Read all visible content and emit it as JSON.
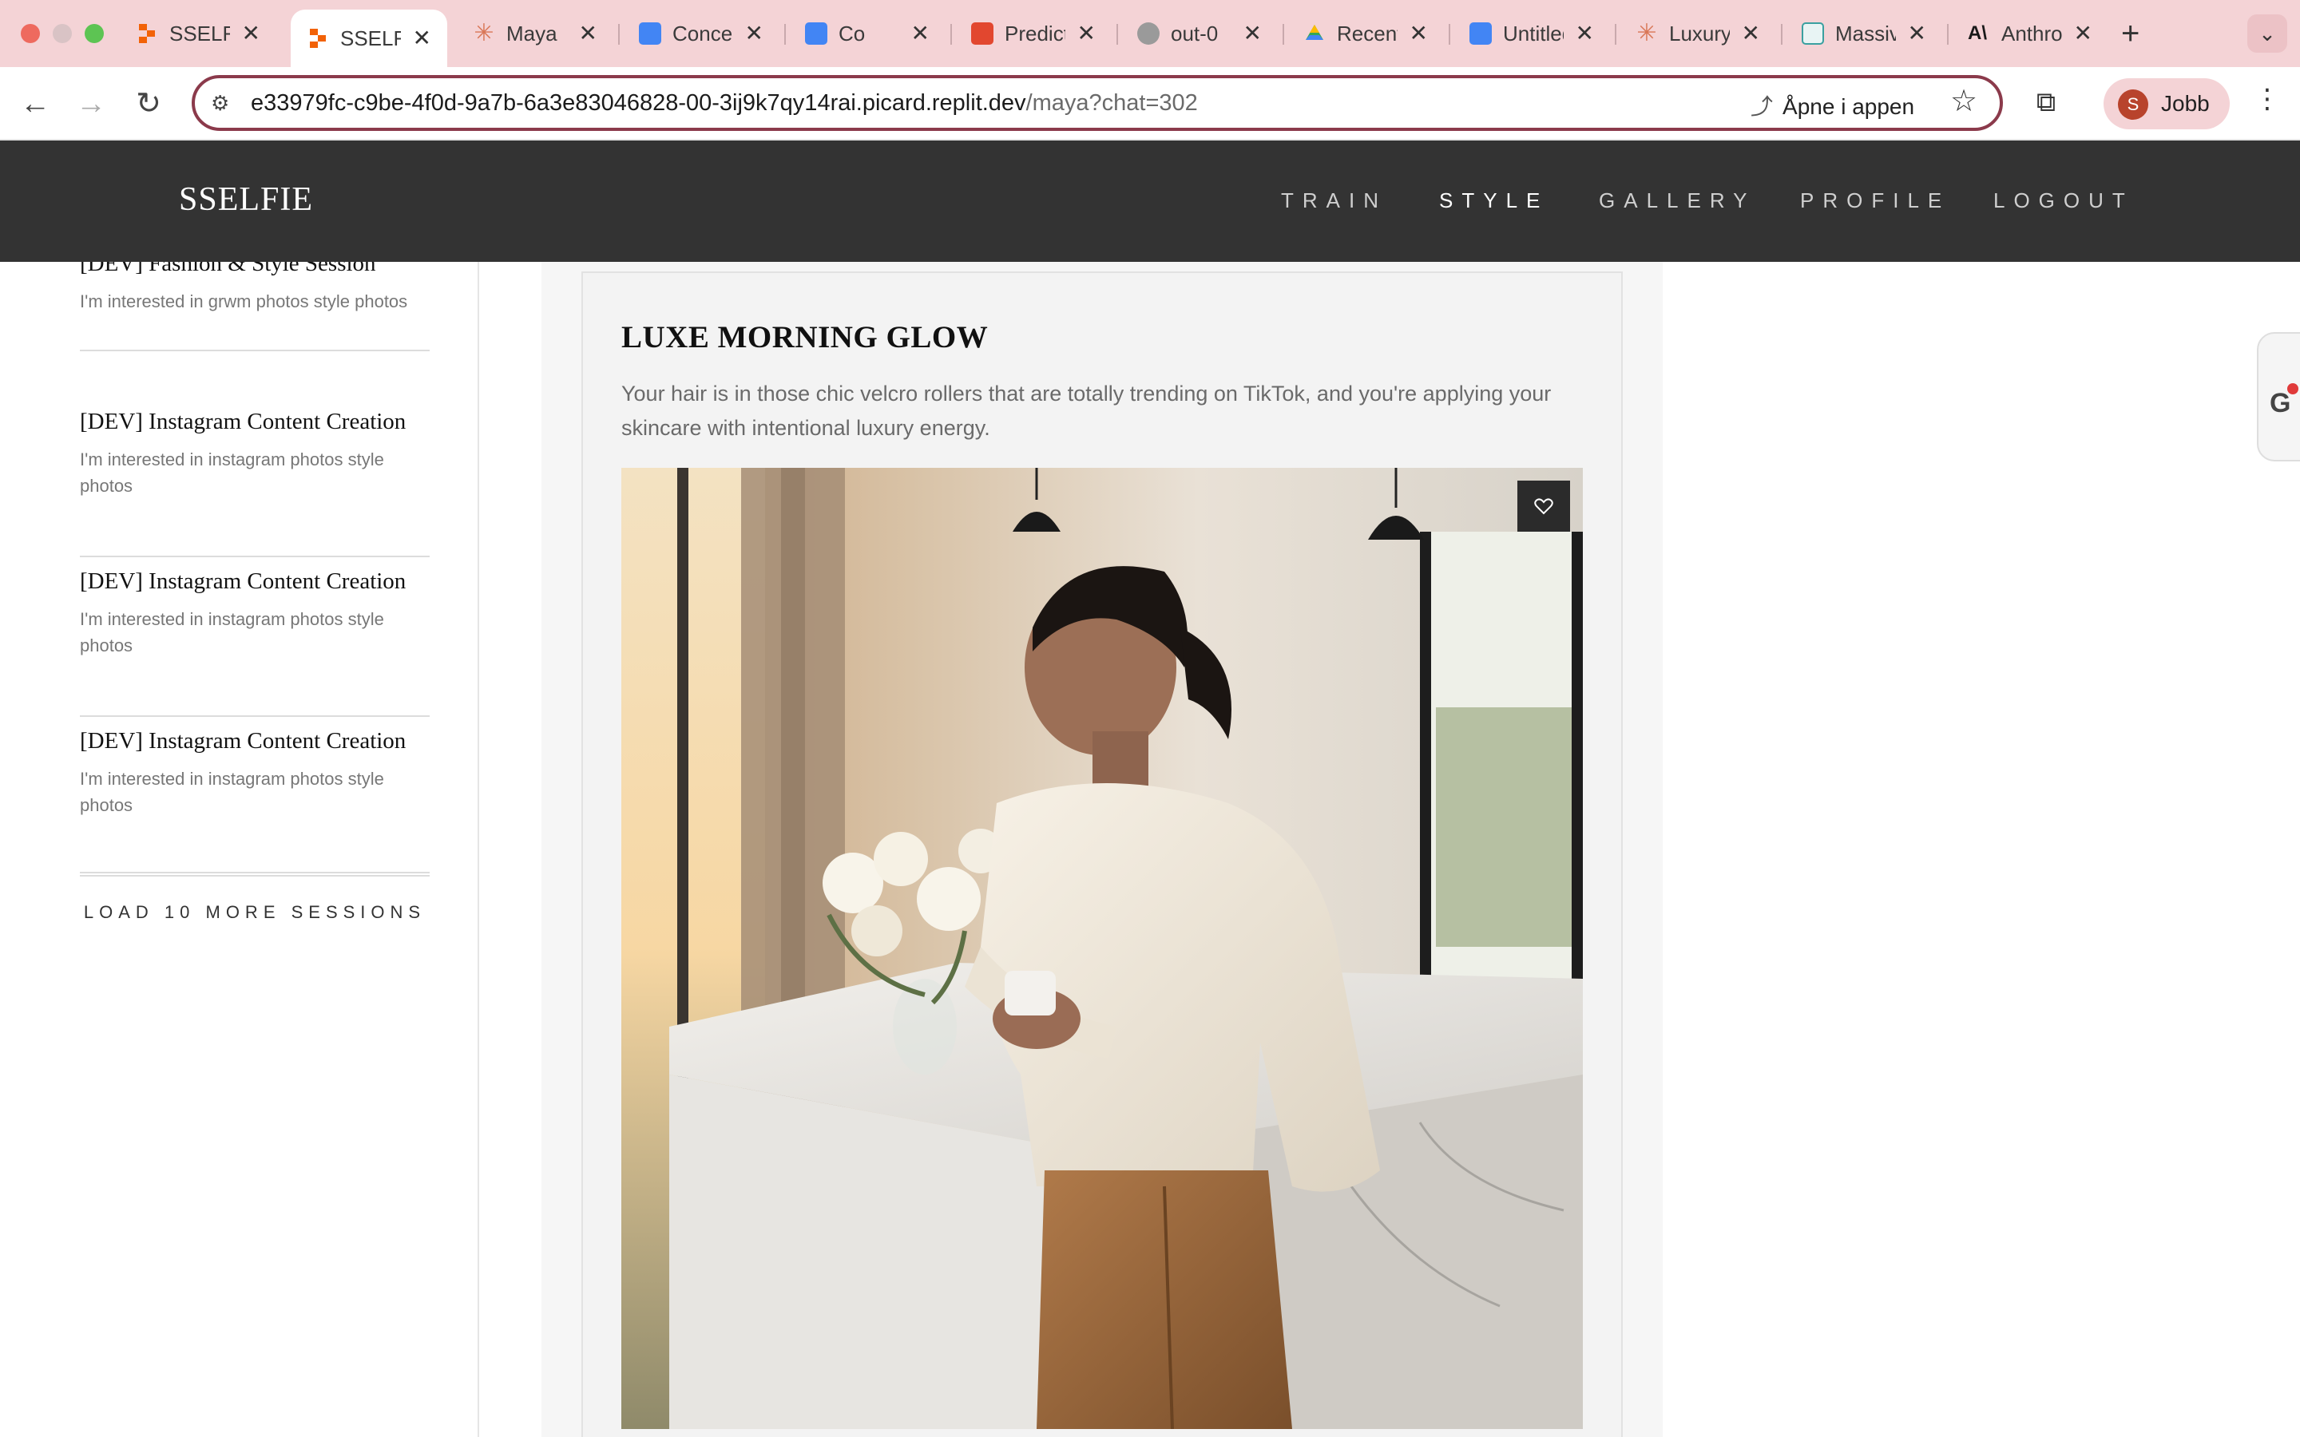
{
  "browser": {
    "tabs": [
      {
        "label": "SSELFIE",
        "favicon": "replit-icon",
        "color": "#f26207",
        "active": false
      },
      {
        "label": "SSELFIE",
        "favicon": "replit-icon",
        "color": "#f26207",
        "active": true
      },
      {
        "label": "Maya",
        "favicon": "claude-icon",
        "color": "#d97757",
        "active": false
      },
      {
        "label": "Concept",
        "favicon": "google-docs-icon",
        "color": "#4285f4",
        "active": false
      },
      {
        "label": "Co",
        "favicon": "google-docs-icon",
        "color": "#4285f4",
        "active": false
      },
      {
        "label": "Predict",
        "favicon": "replicate-icon",
        "color": "#e2472f",
        "active": false
      },
      {
        "label": "out-0",
        "favicon": "globe-icon",
        "color": "#8a8a8a",
        "active": false
      },
      {
        "label": "Recent",
        "favicon": "google-drive-icon",
        "color": "#34a853",
        "active": false
      },
      {
        "label": "Untitled",
        "favicon": "google-docs-icon",
        "color": "#4285f4",
        "active": false
      },
      {
        "label": "Luxury",
        "favicon": "claude-icon",
        "color": "#d97757",
        "active": false
      },
      {
        "label": "Massive",
        "favicon": "app-icon",
        "color": "#3aa0a0",
        "active": false
      },
      {
        "label": "Anthropic",
        "favicon": "anthropic-icon",
        "color": "#191919",
        "active": false
      }
    ],
    "url_host": "e33979fc-c9be-4f0d-9a7b-6a3e83046828-00-3ij9k7qy14rai.picard.replit.dev",
    "url_path": "/maya?chat=302",
    "open_in_app": "Åpne i appen",
    "profile_initial": "S",
    "profile_name": "Jobb"
  },
  "site": {
    "logo": "SSELFIE",
    "nav": [
      "TRAIN",
      "STYLE",
      "GALLERY",
      "PROFILE",
      "LOGOUT"
    ],
    "active_nav": "STYLE"
  },
  "sidebar": {
    "sessions": [
      {
        "title": "[DEV] Fashion & Style Session",
        "desc": "I'm interested in grwm photos style photos"
      },
      {
        "title": "[DEV] Instagram Content Creation",
        "desc": "I'm interested in instagram photos style photos"
      },
      {
        "title": "[DEV] Instagram Content Creation",
        "desc": "I'm interested in instagram photos style photos"
      },
      {
        "title": "[DEV] Instagram Content Creation",
        "desc": "I'm interested in instagram photos style photos"
      }
    ],
    "load_more": "LOAD 10 MORE SESSIONS"
  },
  "card": {
    "title": "LUXE MORNING GLOW",
    "description": "Your hair is in those chic velcro rollers that are totally trending on TikTok, and you're applying your skincare with intentional luxury energy."
  },
  "colors": {
    "header_bg": "#333333",
    "tabstrip_bg": "#f4d3d6",
    "omnibox_border": "#8b3a4b"
  }
}
